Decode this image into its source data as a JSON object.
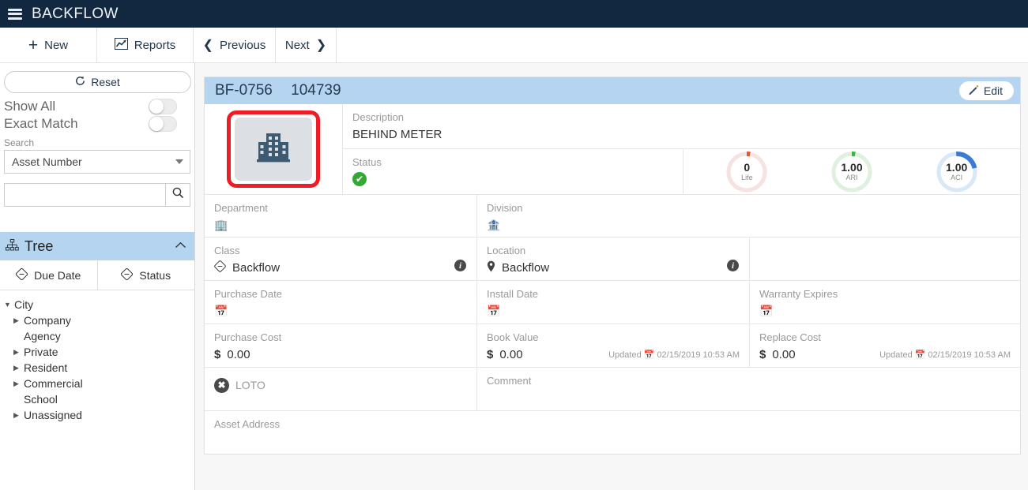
{
  "header": {
    "title": "BACKFLOW",
    "menu_icon": "hamburger-icon"
  },
  "toolbar": {
    "new_label": "New",
    "reports_label": "Reports",
    "previous_label": "Previous",
    "next_label": "Next"
  },
  "sidebar": {
    "reset_label": "Reset",
    "show_all_label": "Show All",
    "exact_match_label": "Exact Match",
    "search_section_label": "Search",
    "search_field_selected": "Asset Number",
    "search_value": "",
    "search_placeholder": "",
    "tree_header_label": "Tree",
    "tabs": [
      {
        "label": "Due Date"
      },
      {
        "label": "Status"
      }
    ],
    "tree_nodes": [
      {
        "label": "City",
        "indent": 0,
        "state": "expanded"
      },
      {
        "label": "Company",
        "indent": 1,
        "state": "collapsed"
      },
      {
        "label": "Agency",
        "indent": 1,
        "state": "leaf"
      },
      {
        "label": "Private",
        "indent": 1,
        "state": "collapsed"
      },
      {
        "label": "Resident",
        "indent": 1,
        "state": "collapsed"
      },
      {
        "label": "Commercial",
        "indent": 1,
        "state": "collapsed"
      },
      {
        "label": "School",
        "indent": 1,
        "state": "leaf"
      },
      {
        "label": "Unassigned",
        "indent": 1,
        "state": "collapsed"
      }
    ]
  },
  "record": {
    "asset_id": "BF-0756",
    "asset_number": "104739",
    "edit_label": "Edit",
    "photo_icon": "building-icon",
    "description_label": "Description",
    "description_value": "BEHIND METER",
    "status_label": "Status",
    "status_icon": "check-circle-icon",
    "gauges": [
      {
        "value": "0",
        "label": "Life",
        "color": "#e8533c",
        "track": "#f6e2e0",
        "pct": 3
      },
      {
        "value": "1.00",
        "label": "ARI",
        "color": "#3cb44a",
        "track": "#dff0df",
        "pct": 3
      },
      {
        "value": "1.00",
        "label": "ACI",
        "color": "#3a7bd5",
        "track": "#d8e8f7",
        "pct": 22
      }
    ],
    "fields": {
      "department_label": "Department",
      "department_value": "",
      "department_icon": "building-small-icon",
      "division_label": "Division",
      "division_value": "",
      "division_icon": "division-icon",
      "class_label": "Class",
      "class_value": "Backflow",
      "class_icon": "tag-icon",
      "location_label": "Location",
      "location_value": "Backflow",
      "location_icon": "map-pin-icon",
      "purchase_date_label": "Purchase Date",
      "purchase_date_value": "",
      "install_date_label": "Install Date",
      "install_date_value": "",
      "warranty_expires_label": "Warranty Expires",
      "warranty_expires_value": "",
      "purchase_cost_label": "Purchase Cost",
      "purchase_cost_value": "0.00",
      "book_value_label": "Book Value",
      "book_value_value": "0.00",
      "book_value_updated": "Updated",
      "book_value_updated_date": "02/15/2019 10:53 AM",
      "replace_cost_label": "Replace Cost",
      "replace_cost_value": "0.00",
      "replace_cost_updated": "Updated",
      "replace_cost_updated_date": "02/15/2019 10:53 AM",
      "currency_symbol": "$",
      "loto_label": "LOTO",
      "comment_label": "Comment",
      "comment_value": "",
      "asset_address_label": "Asset Address",
      "asset_address_value": ""
    }
  },
  "colors": {
    "navy": "#122740",
    "panel_blue": "#b4d4ef",
    "annotation_red": "#ee1c25",
    "status_green": "#34a832"
  }
}
